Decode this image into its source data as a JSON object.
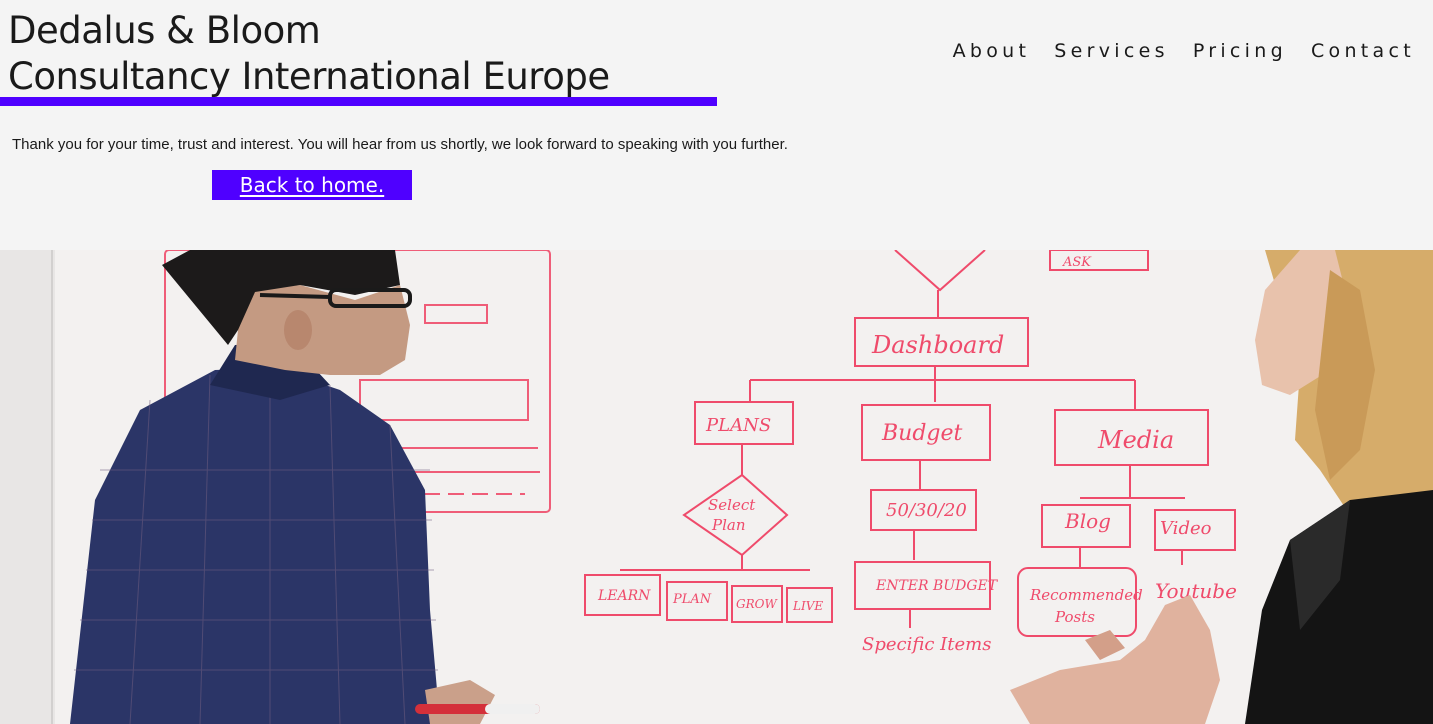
{
  "brand": {
    "line1": "Dedalus & Bloom",
    "line2": "Consultancy International Europe",
    "accent_color": "#4f00ff"
  },
  "nav": {
    "items": [
      "About",
      "Services",
      "Pricing",
      "Contact"
    ]
  },
  "main": {
    "message": "Thank you for your time, trust and interest. You will hear from us shortly, we look forward to speaking with you further.",
    "home_button": "Back to home."
  },
  "hero": {
    "whiteboard": {
      "top": "ASK",
      "root": "Dashboard",
      "branches": [
        "PLANS",
        "Budget",
        "Media"
      ],
      "decision": [
        "Select",
        "Plan"
      ],
      "plan_options": [
        "LEARN",
        "PLAN",
        "GROW",
        "LIVE"
      ],
      "budget_rule": "50/30/20",
      "budget_step": "ENTER BUDGET",
      "budget_end": "Specific Items",
      "media_children": [
        "Blog",
        "Video"
      ],
      "blog_child": [
        "Recommended",
        "Posts"
      ],
      "video_child": "Youtube"
    }
  }
}
